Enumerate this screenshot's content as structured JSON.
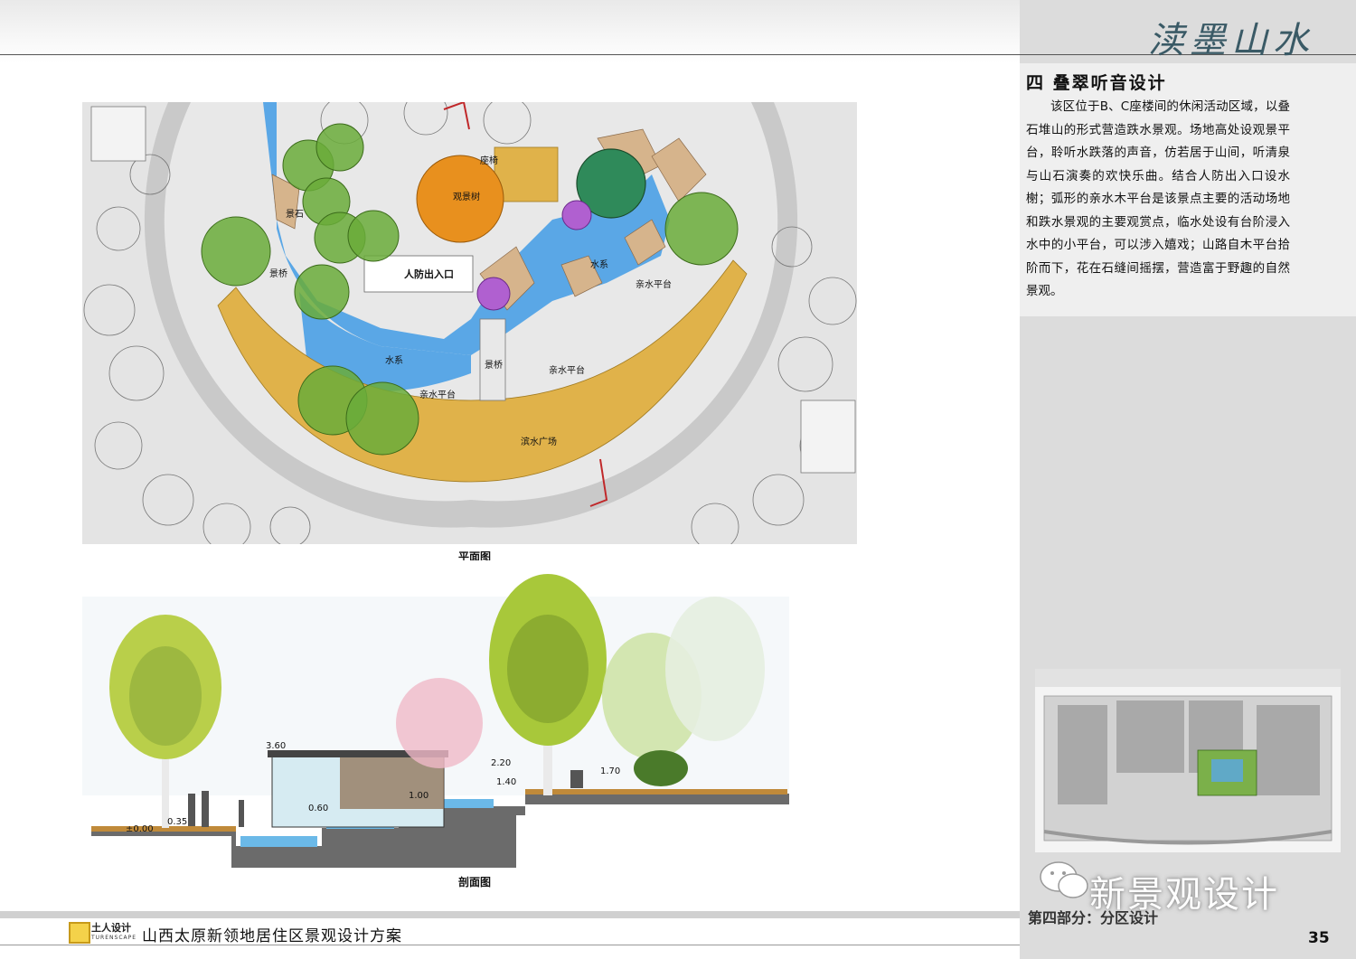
{
  "header": {
    "brush_title": "渎墨山水"
  },
  "section": {
    "title": "四  叠翠听音设计",
    "body": "该区位于B、C座楼间的休闲活动区域，以叠石堆山的形式营造跌水景观。场地高处设观景平台，聆听水跌落的声音，仿若居于山间，听清泉与山石演奏的欢快乐曲。结合人防出入口设水榭；弧形的亲水木平台是该景点主要的活动场地和跌水景观的主要观赏点，临水处设有台阶浸入水中的小平台，可以涉入嬉戏；山路自木平台拾阶而下，花在石缝间摇摆，营造富于野趣的自然景观。"
  },
  "plan": {
    "caption": "平面图",
    "labels": {
      "seat": "座椅",
      "viewing_tree": "观景树",
      "rock": "景石",
      "bridge_left": "景桥",
      "civil_defense": "人防出入口",
      "water_right": "水系",
      "platform_right": "亲水平台",
      "water_bottom": "水系",
      "bridge_bottom": "景桥",
      "platform_mid": "亲水平台",
      "platform_left": "亲水平台",
      "plaza": "滨水广场"
    }
  },
  "section_view": {
    "caption": "剖面图",
    "elevations": {
      "e0": "±0.00",
      "e1": "0.35",
      "e2": "3.60",
      "e3": "0.60",
      "e4": "1.00",
      "e5": "2.20",
      "e6": "1.40",
      "e7": "1.70"
    }
  },
  "footer": {
    "logo_cn": "土人设计",
    "logo_en": "TURENSCAPE",
    "project_title": "山西太原新领地居住区景观设计方案",
    "part_label": "第四部分：分区设计",
    "page_number": "35",
    "watermark": "新景观设计"
  },
  "colors": {
    "water": "#5aa7e6",
    "deck": "#e0b24a",
    "tree_green": "#6aab3a",
    "tree_orange": "#e8901e",
    "tree_purple": "#b060d0",
    "paving": "#cfcfcf"
  }
}
